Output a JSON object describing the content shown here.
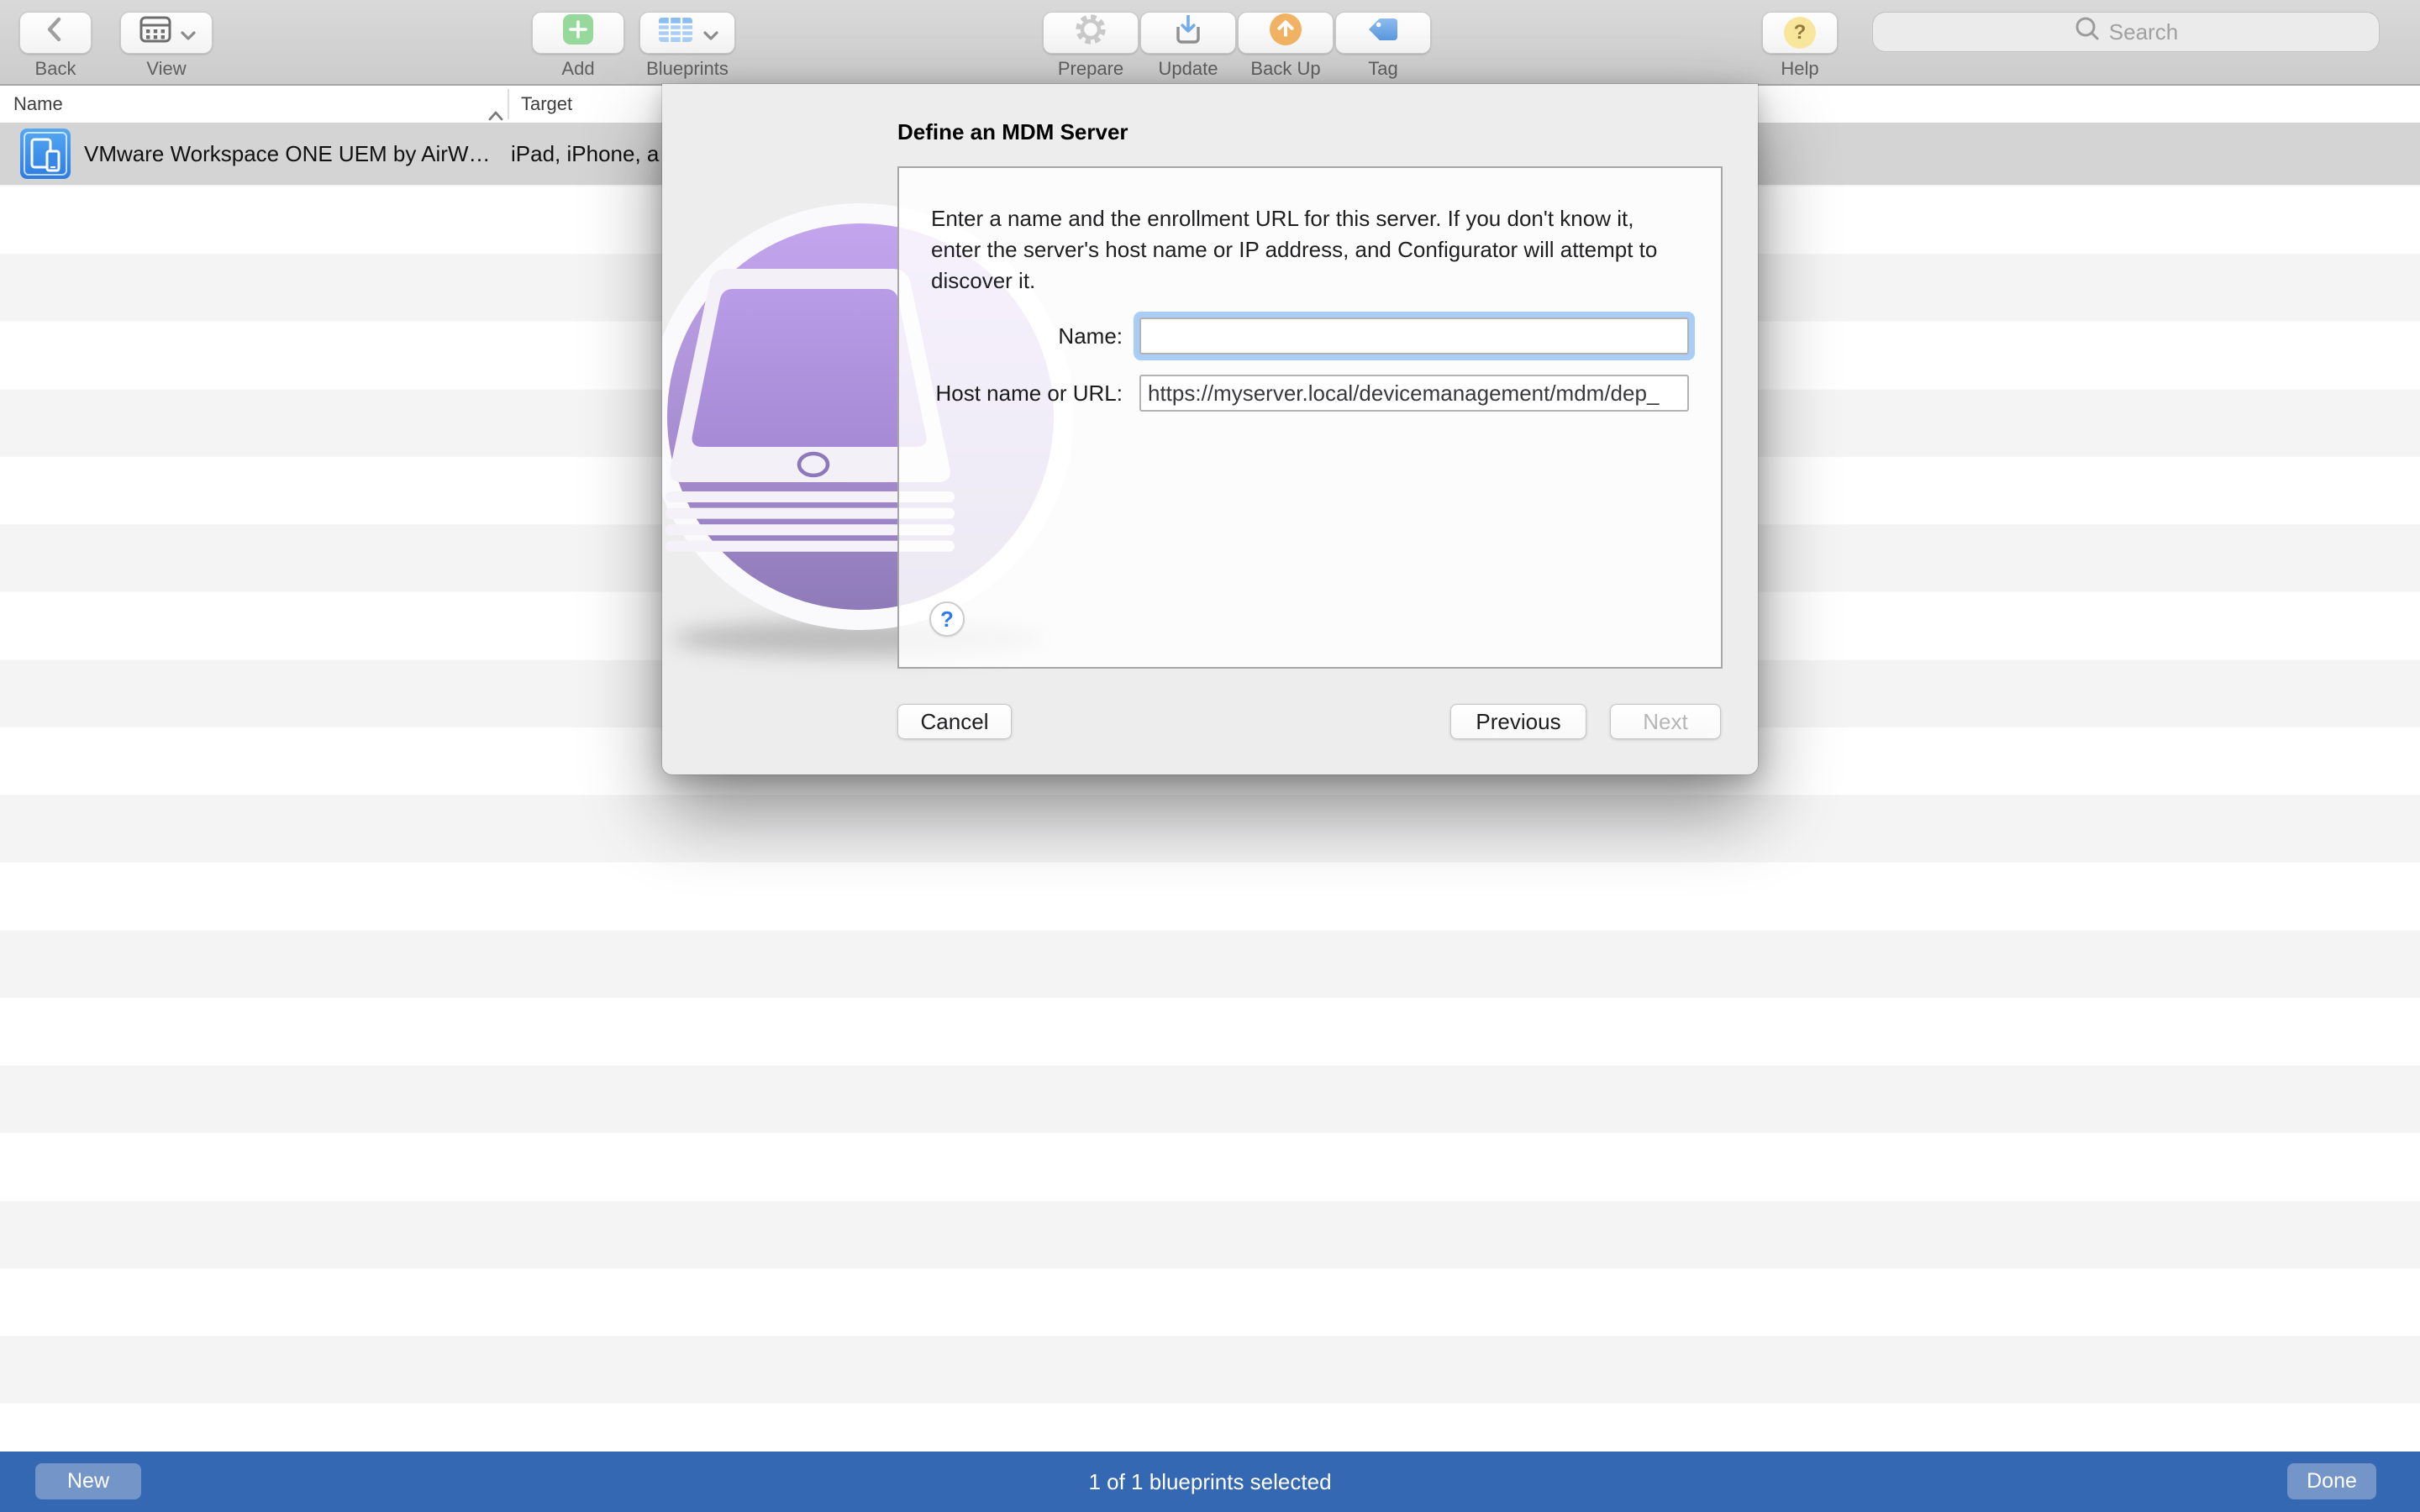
{
  "toolbar": {
    "items": [
      {
        "id": "back",
        "label": "Back"
      },
      {
        "id": "view",
        "label": "View"
      },
      {
        "id": "add",
        "label": "Add"
      },
      {
        "id": "blueprints",
        "label": "Blueprints"
      },
      {
        "id": "prepare",
        "label": "Prepare"
      },
      {
        "id": "update",
        "label": "Update"
      },
      {
        "id": "backup",
        "label": "Back Up"
      },
      {
        "id": "tag",
        "label": "Tag"
      },
      {
        "id": "help",
        "label": "Help"
      }
    ],
    "help_glyph": "?",
    "search": {
      "placeholder": "Search"
    }
  },
  "table": {
    "columns": [
      {
        "label": "Name",
        "sort_indicator": "^"
      },
      {
        "label": "Target"
      }
    ],
    "rows": [
      {
        "name": "VMware Workspace ONE UEM by AirW…",
        "target": "iPad, iPhone, a"
      }
    ]
  },
  "dialog": {
    "title": "Define an MDM Server",
    "instructions": "Enter a name and the enrollment URL for this server. If you don't know it, enter the server's host name or IP address, and Configurator will attempt to discover it.",
    "name_label": "Name:",
    "name_value": "",
    "host_label": "Host name or URL:",
    "host_value": "https://myserver.local/devicemanagement/mdm/dep_",
    "help_glyph": "?",
    "cancel_label": "Cancel",
    "previous_label": "Previous",
    "next_label": "Next"
  },
  "footer": {
    "new_label": "New",
    "status": "1 of 1 blueprints selected",
    "done_label": "Done"
  },
  "colors": {
    "footer_blue": "#3568b2",
    "selected_row": "#d4d4d4",
    "focus_ring": "#a9cdf4",
    "icon_purple": "#a98bd8",
    "add_green": "#97d89b",
    "blueprint_blue": "#a9cdf3",
    "backup_orange": "#f2b264",
    "tag_blue": "#5b97dd",
    "help_yellow": "#f8e69c"
  }
}
